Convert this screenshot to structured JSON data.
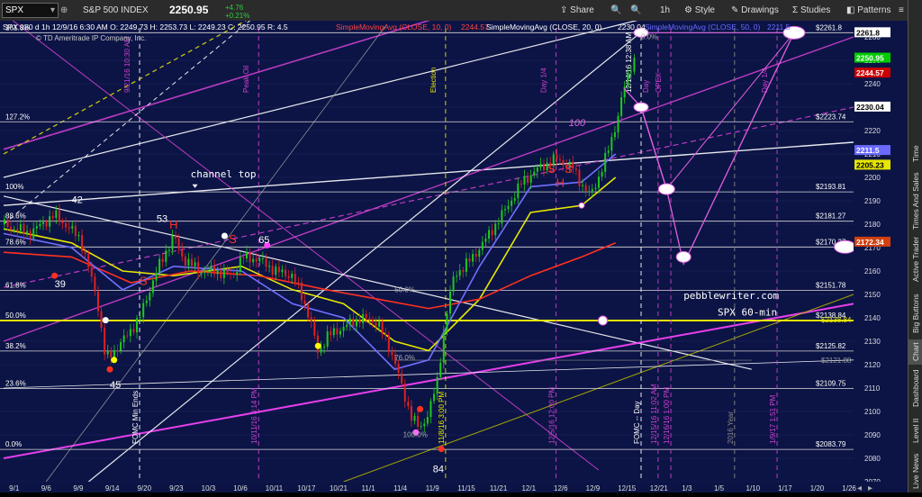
{
  "toolbar": {
    "symbol": "SPX",
    "exchange_name": "S&P 500 INDEX",
    "last": "2250.95",
    "change": "+4.76",
    "change_pct": "+0.21%",
    "share": "Share",
    "interval": "1h",
    "style": "Style",
    "drawings": "Drawings",
    "studies": "Studies",
    "patterns": "Patterns"
  },
  "header": {
    "quote_line": "SPX 180 d 1h  12/9/16 6:30 AM  O: 2249.73  H: 2253.73  L: 2249.23  C: 2250.95  R: 4.5",
    "sma10": "SimpleMovingAvg (CLOSE, 10, 0)",
    "sma10_val": "2244.57",
    "sma20": "SimpleMovingAvg (CLOSE, 20, 0)",
    "sma20_val": "2230.04",
    "sma50": "SimpleMovingAvg (CLOSE, 50, 0)",
    "sma50_val": "2211.5",
    "copyright": "© TD Ameritrade IP Company, Inc."
  },
  "sidebar": {
    "tabs": [
      "Live News",
      "Level II",
      "Dashboard",
      "Chart",
      "Big Buttons",
      "Active Trader",
      "Times And Sales",
      "Time"
    ],
    "active": "Chart"
  },
  "chart_data": {
    "type": "candlestick",
    "title": "SPX 180 d 1h",
    "ylim": [
      2070,
      2265
    ],
    "y_ticks": [
      2070,
      2080,
      2090,
      2100,
      2110,
      2120,
      2130,
      2140,
      2150,
      2160,
      2170,
      2180,
      2190,
      2200,
      2210,
      2220,
      2230,
      2240,
      2250,
      2260
    ],
    "x_ticks": [
      "9/1",
      "9/6",
      "9/9",
      "9/14",
      "9/20",
      "9/23",
      "10/3",
      "10/6",
      "10/11",
      "10/17",
      "10/21",
      "11/1",
      "11/4",
      "11/9",
      "11/15",
      "11/21",
      "12/1",
      "12/6",
      "12/9",
      "12/15",
      "12/21",
      "1/3",
      "1/5",
      "1/10",
      "1/17",
      "1/20",
      "1/26"
    ],
    "price_path": [
      [
        0,
        2180
      ],
      [
        3,
        2176
      ],
      [
        6,
        2184
      ],
      [
        9,
        2174
      ],
      [
        11,
        2148
      ],
      [
        12,
        2122
      ],
      [
        14,
        2130
      ],
      [
        16,
        2140
      ],
      [
        17,
        2150
      ],
      [
        18,
        2160
      ],
      [
        20,
        2175
      ],
      [
        21,
        2166
      ],
      [
        23,
        2160
      ],
      [
        25,
        2160
      ],
      [
        27,
        2158
      ],
      [
        28,
        2166
      ],
      [
        30,
        2165
      ],
      [
        32,
        2160
      ],
      [
        34,
        2158
      ],
      [
        35,
        2150
      ],
      [
        36,
        2140
      ],
      [
        37,
        2125
      ],
      [
        38,
        2132
      ],
      [
        40,
        2136
      ],
      [
        42,
        2140
      ],
      [
        44,
        2138
      ],
      [
        45,
        2130
      ],
      [
        46,
        2122
      ],
      [
        47,
        2108
      ],
      [
        48,
        2098
      ],
      [
        49,
        2092
      ],
      [
        50,
        2100
      ],
      [
        51,
        2112
      ],
      [
        52,
        2140
      ],
      [
        53,
        2158
      ],
      [
        55,
        2165
      ],
      [
        57,
        2175
      ],
      [
        59,
        2186
      ],
      [
        61,
        2198
      ],
      [
        63,
        2204
      ],
      [
        65,
        2208
      ],
      [
        67,
        2204
      ],
      [
        68,
        2197
      ],
      [
        69,
        2192
      ],
      [
        70,
        2200
      ],
      [
        71,
        2210
      ],
      [
        72,
        2222
      ],
      [
        73,
        2238
      ],
      [
        74,
        2250
      ],
      [
        74.5,
        2251
      ]
    ],
    "series": [
      {
        "name": "SimpleMovingAvg (CLOSE, 10, 0)",
        "last": 2244.57,
        "color": "#ff2020"
      },
      {
        "name": "SimpleMovingAvg (CLOSE, 20, 0)",
        "last": 2230.04,
        "color": "#ffffff"
      },
      {
        "name": "SimpleMovingAvg (CLOSE, 50, 0)",
        "last": 2211.5,
        "color": "#7f7fff"
      }
    ],
    "ma_paths": {
      "yellow": [
        [
          0,
          2178
        ],
        [
          8,
          2172
        ],
        [
          14,
          2160
        ],
        [
          20,
          2158
        ],
        [
          28,
          2162
        ],
        [
          34,
          2152
        ],
        [
          40,
          2146
        ],
        [
          46,
          2130
        ],
        [
          50,
          2126
        ],
        [
          56,
          2148
        ],
        [
          62,
          2185
        ],
        [
          68,
          2188
        ],
        [
          72,
          2200
        ]
      ],
      "red": [
        [
          0,
          2168
        ],
        [
          8,
          2166
        ],
        [
          15,
          2155
        ],
        [
          22,
          2160
        ],
        [
          30,
          2158
        ],
        [
          38,
          2152
        ],
        [
          44,
          2148
        ],
        [
          50,
          2144
        ],
        [
          56,
          2148
        ],
        [
          62,
          2158
        ],
        [
          68,
          2166
        ],
        [
          72,
          2172
        ]
      ],
      "blue": [
        [
          0,
          2176
        ],
        [
          8,
          2170
        ],
        [
          14,
          2152
        ],
        [
          20,
          2162
        ],
        [
          28,
          2160
        ],
        [
          34,
          2146
        ],
        [
          40,
          2140
        ],
        [
          46,
          2118
        ],
        [
          50,
          2122
        ],
        [
          56,
          2162
        ],
        [
          62,
          2196
        ],
        [
          68,
          2198
        ],
        [
          72,
          2210
        ]
      ]
    },
    "price_labels": [
      {
        "value": "2261.8",
        "y": 2261.8,
        "color": "#ffffff"
      },
      {
        "value": "2250.95",
        "y": 2250.95,
        "color": "#00cc00"
      },
      {
        "value": "2244.57",
        "y": 2244.57,
        "color": "#cc0000"
      },
      {
        "value": "2230.04",
        "y": 2230.04,
        "color": "#ffffff"
      },
      {
        "value": "2211.5",
        "y": 2211.5,
        "color": "#6a6aff"
      },
      {
        "value": "2205.23",
        "y": 2205.23,
        "color": "#e6e600"
      },
      {
        "value": "2172.34",
        "y": 2172.34,
        "color": "#d04010"
      }
    ],
    "horizontal_levels": [
      {
        "pct": "161.8%",
        "value": "$2261.8",
        "y": 2261.8
      },
      {
        "pct": "127.2%",
        "value": "$2223.74",
        "y": 2223.74
      },
      {
        "pct": "100%",
        "value": "$2193.81",
        "y": 2193.81
      },
      {
        "pct": "88.6%",
        "value": "$2181.27",
        "y": 2181.27
      },
      {
        "pct": "78.6%",
        "value": "$2170.27",
        "y": 2170.27
      },
      {
        "pct": "61.8%",
        "value": "$2151.78",
        "y": 2151.78
      },
      {
        "pct": "50.0%",
        "value": "$2138.84",
        "y": 2138.84
      },
      {
        "pct": "38.2%",
        "value": "$2125.82",
        "y": 2125.82
      },
      {
        "pct": "23.6%",
        "value": "$2109.75",
        "y": 2109.75
      },
      {
        "pct": "0.0%",
        "value": "$2083.79",
        "y": 2083.79
      }
    ],
    "yellow_level": {
      "value": "$2138.84",
      "y": 2138.84
    },
    "extra_level": {
      "value": "$2121.88",
      "y": 2121.88
    },
    "vertical_events": [
      {
        "label": "FOMC Min Ends",
        "x": 16
      },
      {
        "label": "9/21/16 10:30 AM",
        "x": 16
      },
      {
        "label": "10/11/16 3:14 PM",
        "x": 30
      },
      {
        "label": "Peak Oil",
        "x": 30
      },
      {
        "label": "11/8/16 3:00 PM",
        "x": 52
      },
      {
        "label": "Election",
        "x": 52
      },
      {
        "label": "12/5/16 12:00 PM",
        "x": 65
      },
      {
        "label": "Day 1/4",
        "x": 65
      },
      {
        "label": "FOMC -- Day",
        "x": 75
      },
      {
        "label": "12/14/16 12:38 AM",
        "x": 75
      },
      {
        "label": "12/15/16 11:02 AM",
        "x": 77
      },
      {
        "label": "Day",
        "x": 77
      },
      {
        "label": "12/16/16 1:00 PM",
        "x": 78.5
      },
      {
        "label": "OPEX",
        "x": 78.5
      },
      {
        "label": "2016 Year",
        "x": 86
      },
      {
        "label": "1/9/17 1:51 PM",
        "x": 91
      },
      {
        "label": "Day 1/4",
        "x": 91
      }
    ],
    "annotations": [
      {
        "text": "channel top",
        "x": 22,
        "y": 2200
      },
      {
        "text": "pebblewriter.com",
        "x": 80,
        "y": 2148
      },
      {
        "text": "SPX 60-min",
        "x": 84,
        "y": 2141
      },
      {
        "text": "42",
        "x": 8,
        "y": 2189
      },
      {
        "text": "53",
        "x": 18,
        "y": 2181
      },
      {
        "text": "65",
        "x": 30,
        "y": 2172
      },
      {
        "text": "39",
        "x": 6,
        "y": 2153
      },
      {
        "text": "45",
        "x": 12.5,
        "y": 2110
      },
      {
        "text": "84",
        "x": 50.5,
        "y": 2074
      },
      {
        "text": "S",
        "x": 26.5,
        "y": 2172
      },
      {
        "text": "S",
        "x": 16,
        "y": 2154
      },
      {
        "text": "H",
        "x": 19.5,
        "y": 2178
      },
      {
        "text": "S",
        "x": 64,
        "y": 2202
      },
      {
        "text": "S",
        "x": 66,
        "y": 2202
      },
      {
        "text": "H",
        "x": 65,
        "y": 2196
      },
      {
        "text": "100",
        "x": 66.5,
        "y": 2222
      },
      {
        "text": "100.0%",
        "x": 47,
        "y": 2089
      },
      {
        "text": "0.0%",
        "x": 75,
        "y": 2259
      },
      {
        "text": "50.0%",
        "x": 46,
        "y": 2151
      },
      {
        "text": "76.0%",
        "x": 46,
        "y": 2122
      }
    ]
  }
}
